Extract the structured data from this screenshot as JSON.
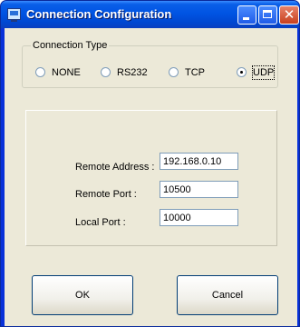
{
  "window": {
    "title": "Connection Configuration",
    "icon": "computer-icon"
  },
  "titlebar_buttons": {
    "minimize": "minimize-icon",
    "maximize": "maximize-icon",
    "close_glyph": "✕"
  },
  "connection_type": {
    "label": "Connection Type",
    "options": [
      {
        "label": "NONE",
        "selected": false
      },
      {
        "label": "RS232",
        "selected": false
      },
      {
        "label": "TCP",
        "selected": false
      },
      {
        "label": "UDP",
        "selected": true
      }
    ]
  },
  "settings": {
    "remote_address": {
      "label": "Remote Address :",
      "value": "192.168.0.10"
    },
    "remote_port": {
      "label": "Remote Port :",
      "value": "10500"
    },
    "local_port": {
      "label": "Local Port :",
      "value": "10000"
    }
  },
  "buttons": {
    "ok": "OK",
    "cancel": "Cancel"
  },
  "colors": {
    "title_bar": "#0054e3",
    "dialog_face": "#ece9d8",
    "field_border": "#7f9db9",
    "button_border": "#003c74"
  }
}
